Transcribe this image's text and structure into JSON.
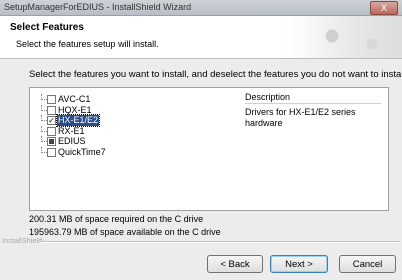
{
  "window": {
    "title": "SetupManagerForEDIUS - InstallShield Wizard",
    "close_label": "X"
  },
  "header": {
    "title": "Select Features",
    "subtitle": "Select the features setup will install."
  },
  "instruction": "Select the features you want to install, and deselect the features you do not want to install.",
  "features": [
    {
      "label": "AVC-C1",
      "checked": false,
      "partial": false,
      "selected": false
    },
    {
      "label": "HQX-E1",
      "checked": false,
      "partial": false,
      "selected": false
    },
    {
      "label": "HX-E1/E2",
      "checked": true,
      "partial": false,
      "selected": true
    },
    {
      "label": "RX-E1",
      "checked": false,
      "partial": false,
      "selected": false
    },
    {
      "label": "EDIUS",
      "checked": false,
      "partial": true,
      "selected": false
    },
    {
      "label": "QuickTime7",
      "checked": false,
      "partial": false,
      "selected": false
    }
  ],
  "description": {
    "title": "Description",
    "text": "Drivers for HX-E1/E2 series hardware"
  },
  "space": {
    "required": "200.31 MB of space required on the C drive",
    "available": "195963.79 MB of space available on the C drive"
  },
  "brand": "InstallShield",
  "buttons": {
    "back": "< Back",
    "next": "Next >",
    "cancel": "Cancel"
  }
}
